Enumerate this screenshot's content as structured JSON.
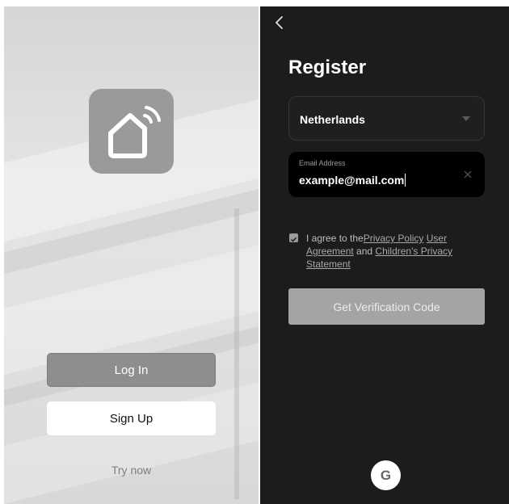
{
  "login_screen": {
    "login_label": "Log In",
    "signup_label": "Sign Up",
    "try_now_label": "Try now",
    "logo_icon": "smart-home-wifi-icon"
  },
  "register_screen": {
    "back_icon": "chevron-left-icon",
    "title": "Register",
    "country": {
      "value": "Netherlands",
      "icon": "caret-down-icon"
    },
    "email": {
      "label": "Email Address",
      "value": "example@mail.com",
      "clear_icon": "close-icon"
    },
    "agreement": {
      "checked": true,
      "prefix": "I agree to the",
      "privacy_policy": "Privacy Policy",
      "user_agreement": "User Agreement",
      "and": " and ",
      "childrens_privacy": "Children's Privacy Statement"
    },
    "verify_label": "Get Verification Code",
    "google_label": "G"
  },
  "colors": {
    "dark_bg": "#1c1c1c",
    "login_button": "#8e8e8e",
    "verify_button": "#a4a4a4"
  }
}
